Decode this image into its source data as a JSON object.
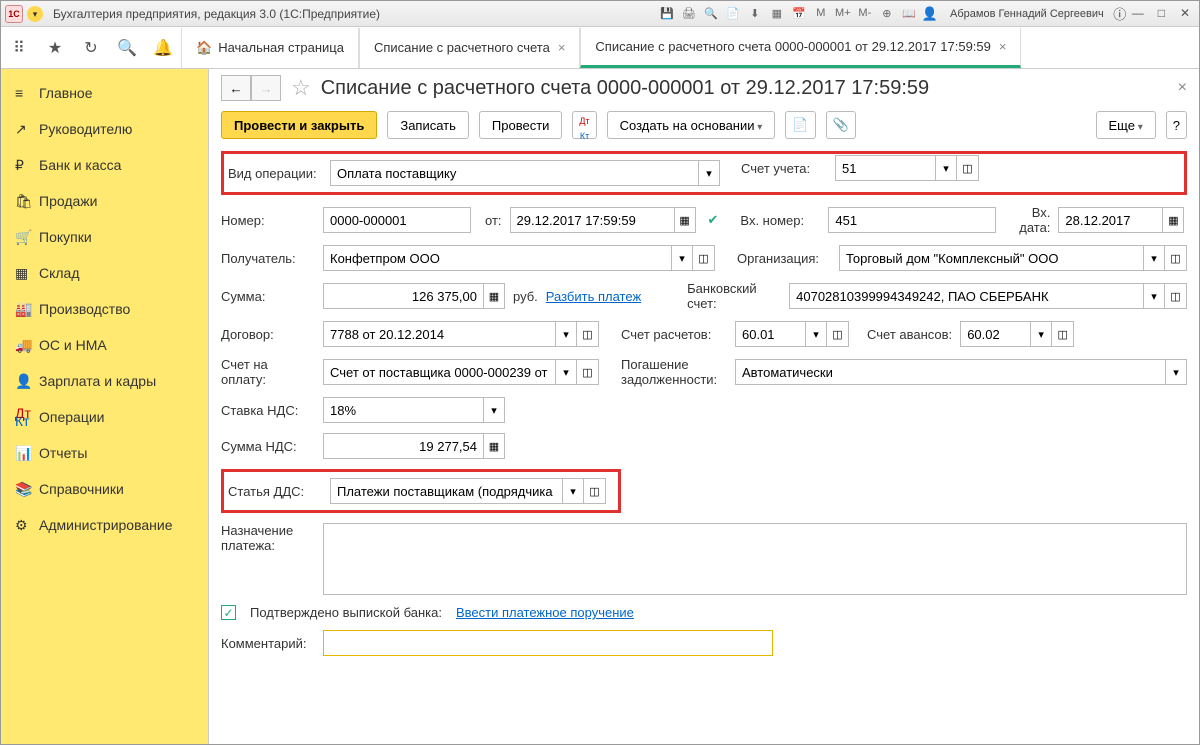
{
  "titlebar": {
    "logo": "1C",
    "title": "Бухгалтерия предприятия, редакция 3.0  (1С:Предприятие)",
    "user": "Абрамов Геннадий Сергеевич"
  },
  "toolbar_icons": [
    "M",
    "M+",
    "M-"
  ],
  "tabs": {
    "home": "Начальная страница",
    "t1": "Списание с расчетного счета",
    "t2": "Списание с расчетного счета 0000-000001 от 29.12.2017 17:59:59"
  },
  "sidebar": [
    {
      "icon": "≡",
      "label": "Главное"
    },
    {
      "icon": "↗",
      "label": "Руководителю"
    },
    {
      "icon": "₽",
      "label": "Банк и касса"
    },
    {
      "icon": "🛍",
      "label": "Продажи"
    },
    {
      "icon": "🛒",
      "label": "Покупки"
    },
    {
      "icon": "▦",
      "label": "Склад"
    },
    {
      "icon": "🏭",
      "label": "Производство"
    },
    {
      "icon": "🚚",
      "label": "ОС и НМА"
    },
    {
      "icon": "👤",
      "label": "Зарплата и кадры"
    },
    {
      "icon": "Дт/Кт",
      "label": "Операции"
    },
    {
      "icon": "📊",
      "label": "Отчеты"
    },
    {
      "icon": "📚",
      "label": "Справочники"
    },
    {
      "icon": "⚙",
      "label": "Администрирование"
    }
  ],
  "page": {
    "title": "Списание с расчетного счета 0000-000001 от 29.12.2017 17:59:59",
    "actions": {
      "post_close": "Провести и закрыть",
      "save": "Записать",
      "post": "Провести",
      "create_based": "Создать на основании",
      "more": "Еще",
      "help": "?"
    },
    "form": {
      "op_type_lbl": "Вид операции:",
      "op_type": "Оплата поставщику",
      "account_lbl": "Счет учета:",
      "account": "51",
      "number_lbl": "Номер:",
      "number": "0000-000001",
      "from_lbl": "от:",
      "date": "29.12.2017 17:59:59",
      "in_number_lbl": "Вх. номер:",
      "in_number": "451",
      "in_date_lbl": "Вх. дата:",
      "in_date": "28.12.2017",
      "recipient_lbl": "Получатель:",
      "recipient": "Конфетпром ООО",
      "org_lbl": "Организация:",
      "org": "Торговый дом \"Комплексный\" ООО",
      "sum_lbl": "Сумма:",
      "sum": "126 375,00",
      "currency": "руб.",
      "split_link": "Разбить платеж",
      "bank_lbl": "Банковский счет:",
      "bank": "40702810399994349242, ПАО СБЕРБАНК",
      "contract_lbl": "Договор:",
      "contract": "7788 от 20.12.2014",
      "settle_acc_lbl": "Счет расчетов:",
      "settle_acc": "60.01",
      "advance_acc_lbl": "Счет авансов:",
      "advance_acc": "60.02",
      "invoice_lbl": "Счет на оплату:",
      "invoice": "Счет от поставщика 0000-000239 от",
      "debt_lbl": "Погашение задолженности:",
      "debt": "Автоматически",
      "vat_rate_lbl": "Ставка НДС:",
      "vat_rate": "18%",
      "vat_sum_lbl": "Сумма НДС:",
      "vat_sum": "19 277,54",
      "dds_lbl": "Статья ДДС:",
      "dds": "Платежи поставщикам (подрядчика",
      "purpose_lbl": "Назначение платежа:",
      "confirmed": "Подтверждено выпиской банка:",
      "enter_order": "Ввести платежное поручение",
      "comment_lbl": "Комментарий:"
    }
  }
}
